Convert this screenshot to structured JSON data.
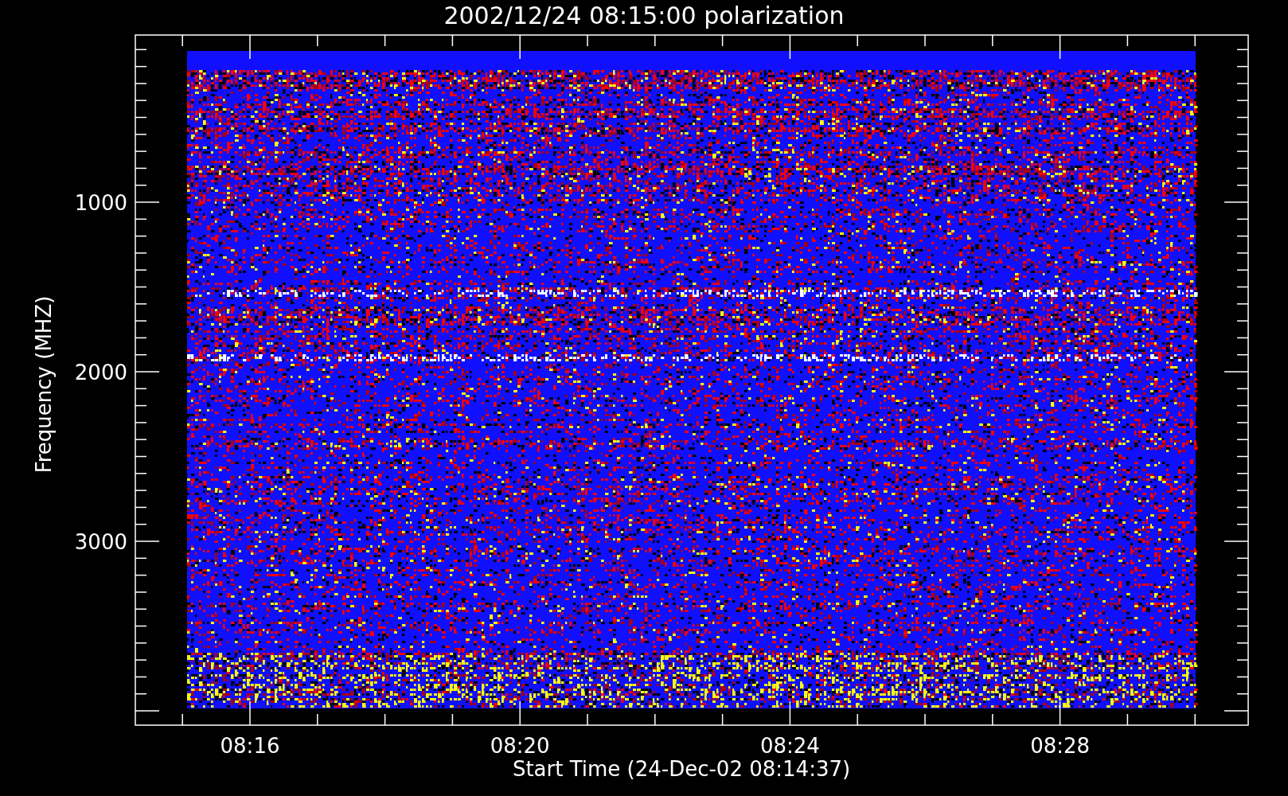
{
  "title": "2002/12/24 08:15:00 polarization",
  "y_axis": {
    "label": "Frequency (MHZ)",
    "ticks": [
      "1000",
      "2000",
      "3000"
    ]
  },
  "x_axis": {
    "label": "Start Time (24-Dec-02 08:14:37)",
    "ticks": [
      "08:16",
      "08:20",
      "08:24",
      "08:28"
    ]
  }
}
